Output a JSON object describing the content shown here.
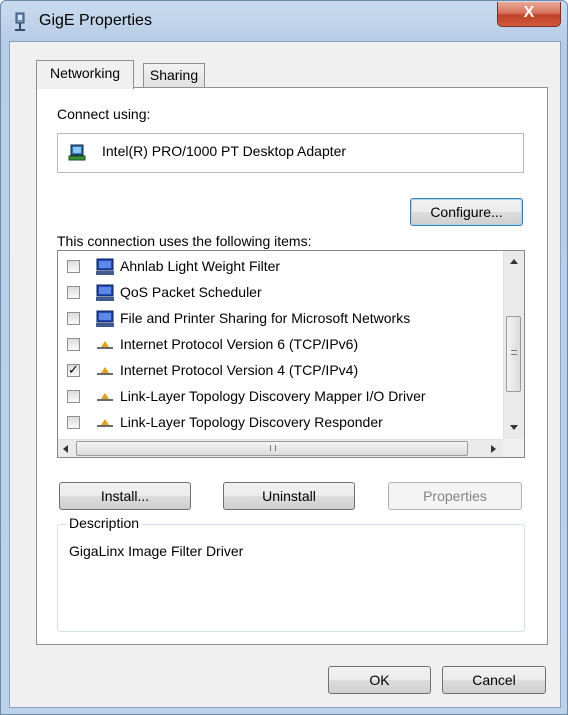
{
  "window": {
    "title": "GigE Properties",
    "close_label": "X"
  },
  "tabs": [
    {
      "label": "Networking",
      "active": true
    },
    {
      "label": "Sharing",
      "active": false
    }
  ],
  "connect_using": {
    "label": "Connect using:",
    "adapter": "Intel(R) PRO/1000 PT Desktop Adapter",
    "adapter_icon": "network-adapter-icon"
  },
  "configure_label": "Configure...",
  "items_label": "This connection uses the following items:",
  "items": [
    {
      "label": "Ahnlab Light Weight Filter",
      "checked": false,
      "icon": "client-computer-icon"
    },
    {
      "label": "QoS Packet Scheduler",
      "checked": false,
      "icon": "client-computer-icon"
    },
    {
      "label": "File and Printer Sharing for Microsoft Networks",
      "checked": false,
      "icon": "client-computer-icon"
    },
    {
      "label": "Internet Protocol Version 6 (TCP/IPv6)",
      "checked": false,
      "icon": "protocol-icon"
    },
    {
      "label": "Internet Protocol Version 4 (TCP/IPv4)",
      "checked": true,
      "icon": "protocol-icon"
    },
    {
      "label": "Link-Layer Topology Discovery Mapper I/O Driver",
      "checked": false,
      "icon": "protocol-icon"
    },
    {
      "label": "Link-Layer Topology Discovery Responder",
      "checked": false,
      "icon": "protocol-icon"
    }
  ],
  "buttons": {
    "install": "Install...",
    "uninstall": "Uninstall",
    "properties": "Properties",
    "ok": "OK",
    "cancel": "Cancel"
  },
  "description": {
    "title": "Description",
    "text": "GigaLinx Image Filter Driver"
  },
  "colors": {
    "title_gradient_top": "#c9dbef",
    "close_button": "#c1412a",
    "check_mark": "#000000"
  }
}
